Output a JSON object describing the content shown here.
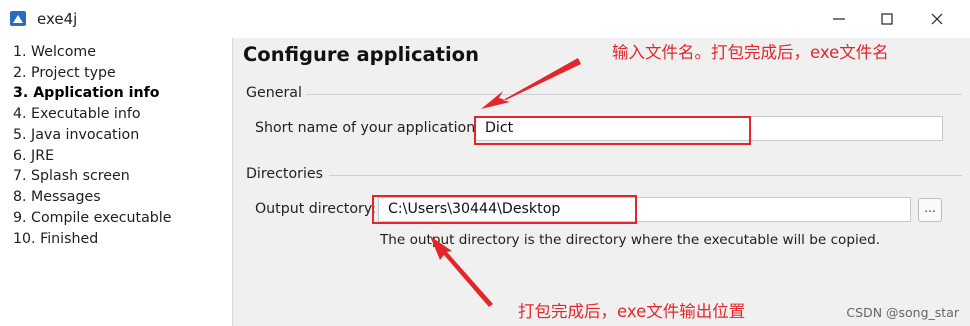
{
  "window": {
    "title": "exe4j",
    "minimize_icon": "minimize-icon",
    "maximize_icon": "maximize-icon",
    "close_icon": "close-icon"
  },
  "sidebar": {
    "steps": [
      {
        "label": "1. Welcome"
      },
      {
        "label": "2. Project type"
      },
      {
        "label": "3. Application info",
        "active": true
      },
      {
        "label": "4. Executable info"
      },
      {
        "label": "5. Java invocation"
      },
      {
        "label": "6. JRE"
      },
      {
        "label": "7. Splash screen"
      },
      {
        "label": "8. Messages"
      },
      {
        "label": "9. Compile executable"
      },
      {
        "label": "10. Finished"
      }
    ]
  },
  "main": {
    "title": "Configure application",
    "general": {
      "label": "General",
      "short_name_label": "Short name of your application:",
      "short_name_value": "Dict"
    },
    "directories": {
      "label": "Directories",
      "output_label": "Output directory:",
      "output_value": "C:\\Users\\30444\\Desktop",
      "browse_label": "...",
      "help_text": "The output directory is the directory where the executable will be copied."
    }
  },
  "annotations": {
    "top_note": "输入文件名。打包完成后，exe文件名",
    "bottom_note": "打包完成后，exe文件输出位置",
    "accent_color": "#e3262b"
  },
  "watermark": "CSDN @song_star"
}
